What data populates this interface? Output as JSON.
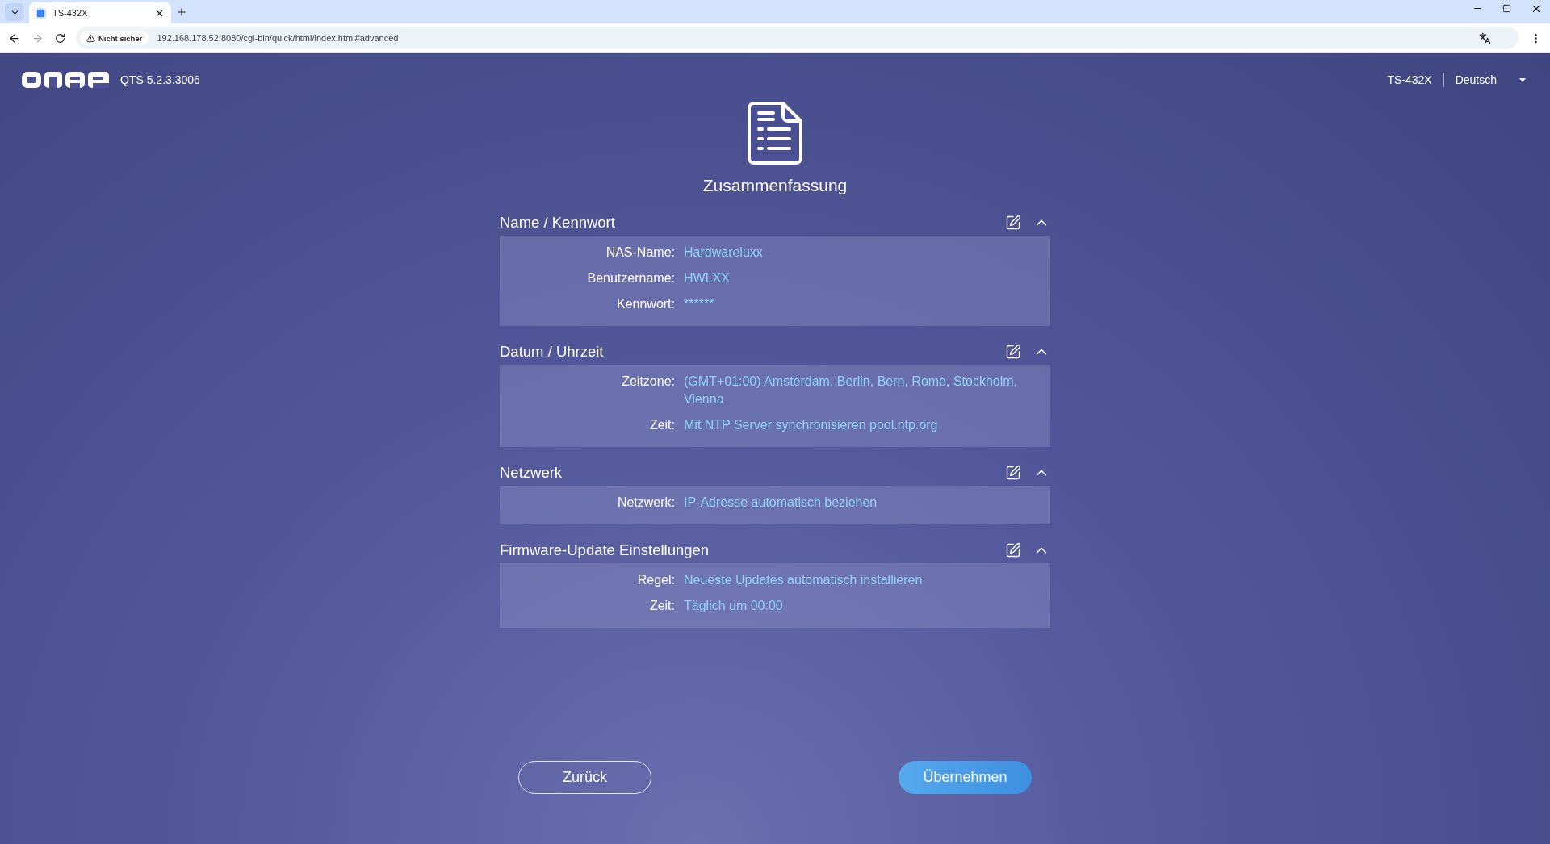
{
  "browser": {
    "tab_title": "TS-432X",
    "security_label": "Nicht sicher",
    "url": "192.168.178.52:8080/cgi-bin/quick/html/index.html#advanced"
  },
  "header": {
    "version": "QTS 5.2.3.3006",
    "device": "TS-432X",
    "language": "Deutsch"
  },
  "title": "Zusammenfassung",
  "sections": [
    {
      "title": "Name / Kennwort",
      "expanded": true,
      "rows": [
        {
          "label": "NAS-Name:",
          "value": "Hardwareluxx"
        },
        {
          "label": "Benutzername:",
          "value": "HWLXX"
        },
        {
          "label": "Kennwort:",
          "value": "******"
        }
      ]
    },
    {
      "title": "Datum / Uhrzeit",
      "expanded": true,
      "rows": [
        {
          "label": "Zeitzone:",
          "value": "(GMT+01:00) Amsterdam, Berlin, Bern, Rome, Stockholm, Vienna"
        },
        {
          "label": "Zeit:",
          "value": "Mit NTP Server synchronisieren pool.ntp.org"
        }
      ]
    },
    {
      "title": "Netzwerk",
      "expanded": true,
      "rows": [
        {
          "label": "Netzwerk:",
          "value": "IP-Adresse automatisch beziehen"
        }
      ]
    },
    {
      "title": "Firmware-Update Einstellungen",
      "expanded": true,
      "rows": [
        {
          "label": "Regel:",
          "value": "Neueste Updates automatisch installieren"
        },
        {
          "label": "Zeit:",
          "value": "Täglich um 00:00"
        }
      ]
    }
  ],
  "buttons": [
    {
      "label": "Zurück",
      "kind": "secondary"
    },
    {
      "label": "Übernehmen",
      "kind": "primary"
    }
  ]
}
